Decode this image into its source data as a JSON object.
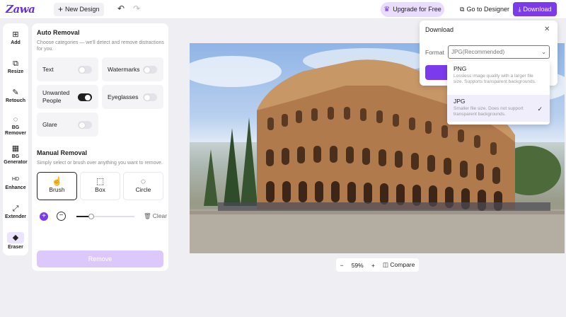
{
  "header": {
    "logo": "Zawa",
    "new_design": "New Design",
    "upgrade": "Upgrade for Free",
    "go_to_designer": "Go to Designer",
    "download": "Download"
  },
  "tools": [
    {
      "label": "Add",
      "icon": "⊞"
    },
    {
      "label": "Resize",
      "icon": "⧉"
    },
    {
      "label": "Retouch",
      "icon": "✎"
    },
    {
      "label": "BG Remover",
      "icon": "◌"
    },
    {
      "label": "BG Generator",
      "icon": "▦"
    },
    {
      "label": "Enhance",
      "icon": "HD"
    },
    {
      "label": "Extender",
      "icon": "⤢"
    },
    {
      "label": "Eraser",
      "icon": "◆"
    }
  ],
  "auto_removal": {
    "title": "Auto Removal",
    "desc": "Choose categories — we'll detect and remove distractions for you.",
    "options": [
      {
        "label": "Text",
        "on": false
      },
      {
        "label": "Watermarks",
        "on": false
      },
      {
        "label": "Unwanted People",
        "on": true
      },
      {
        "label": "Eyeglasses",
        "on": false
      },
      {
        "label": "Glare",
        "on": false
      }
    ]
  },
  "manual_removal": {
    "title": "Manual Removal",
    "desc": "Simply select or brush over anything you want to remove.",
    "modes": [
      "Brush",
      "Box",
      "Circle"
    ],
    "clear": "Clear",
    "brush_size": 0.25
  },
  "remove_button": "Remove",
  "zoom": {
    "minus": "−",
    "value": "59%",
    "plus": "+",
    "compare": "Compare"
  },
  "download_dialog": {
    "title": "Download",
    "format_label": "Format",
    "selected_format": "JPG",
    "selected_note": "(Recommended)",
    "options": [
      {
        "name": "PNG",
        "desc": "Lossless image quality with a larger file size. Supports transparent backgrounds."
      },
      {
        "name": "JPG",
        "desc": "Smaller file size. Does not support transparent backgrounds."
      }
    ]
  },
  "colors": {
    "accent": "#7c3aed",
    "upgrade_bg": "#e9dcfd",
    "remove_disabled": "#dcc8fb"
  }
}
